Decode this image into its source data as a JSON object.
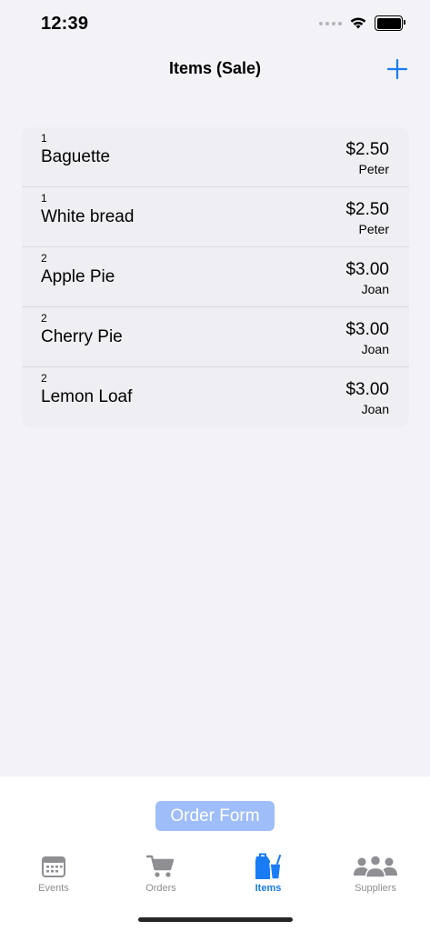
{
  "status_bar": {
    "time": "12:39"
  },
  "nav": {
    "title": "Items (Sale)",
    "add_icon": "plus-icon"
  },
  "items": [
    {
      "qty": "1",
      "name": "Baguette",
      "price": "$2.50",
      "supplier": "Peter"
    },
    {
      "qty": "1",
      "name": "White bread",
      "price": "$2.50",
      "supplier": "Peter"
    },
    {
      "qty": "2",
      "name": "Apple Pie",
      "price": "$3.00",
      "supplier": "Joan"
    },
    {
      "qty": "2",
      "name": "Cherry Pie",
      "price": "$3.00",
      "supplier": "Joan"
    },
    {
      "qty": "2",
      "name": "Lemon Loaf",
      "price": "$3.00",
      "supplier": "Joan"
    }
  ],
  "order_form": {
    "label": "Order Form"
  },
  "tabs": [
    {
      "label": "Events",
      "icon": "calendar-icon"
    },
    {
      "label": "Orders",
      "icon": "cart-icon"
    },
    {
      "label": "Items",
      "icon": "bag-cup-icon",
      "active": true
    },
    {
      "label": "Suppliers",
      "icon": "people-icon"
    }
  ],
  "colors": {
    "accent": "#1a7cf5",
    "inactive": "#8e8e93",
    "background": "#f2f2f7",
    "button_disabled": "#9fbdf8"
  }
}
